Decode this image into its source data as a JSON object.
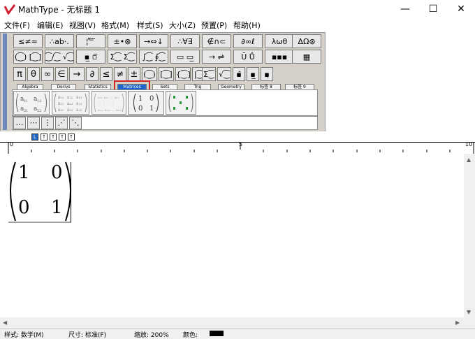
{
  "window": {
    "title": "MathType - 无标题 1",
    "controls": {
      "minimize": "—",
      "maximize": "☐",
      "close": "✕"
    }
  },
  "menu": [
    "文件(F)",
    "编辑(E)",
    "视图(V)",
    "格式(M)",
    "样式(S)",
    "大小(Z)",
    "预置(P)",
    "帮助(H)"
  ],
  "palette": {
    "row1": [
      "≤≠≈",
      "∴ab·.",
      "¦ ̊ ̿ ̈",
      "±•⊗",
      "→⇔↓",
      "∴∀∃",
      "∉∩⊂",
      "∂∞ℓ",
      "λωθ",
      "ΔΩ⊛"
    ],
    "row2": [
      "(⁐) [⁐]",
      "⁐/⁐ √⁐",
      "▪̲ ▫̅",
      "Σ⁐ Σ⁐",
      "∫⁐ ∮⁐",
      "▭ ▭̲",
      "→ ⇌",
      "Ū Ů",
      "▪▪▪",
      "▦"
    ],
    "row3": [
      "π",
      "θ",
      "∞",
      "∈",
      "→",
      "∂",
      "≤",
      "≠",
      "±",
      "(⁐)",
      "[⁐]",
      "{⁐}",
      "|⁐|",
      "Σ⁐",
      "√⁐",
      "▪̂",
      "▪̲",
      "▪̣"
    ],
    "tabs": [
      "Algebra",
      "Derivs",
      "Statistics",
      "Matrices",
      "Sets",
      "Trig",
      "Geometry",
      "标签 8",
      "标签 9"
    ],
    "selected_tab": "Matrices",
    "templates": [
      "a11 a12 / a21 a22",
      "3×3 matrix",
      "m×n matrix",
      "1 0 / 0 1",
      "diagonal matrix"
    ],
    "dots_row": [
      "…",
      "⋯",
      "⋮",
      "⋰",
      "⋱"
    ]
  },
  "ruler_buttons": [
    "L",
    "↑",
    "↑",
    "↑",
    "↑"
  ],
  "ruler_labels": [
    "0",
    "5",
    "10"
  ],
  "equation": {
    "matrix": [
      [
        "1",
        "0"
      ],
      [
        "0",
        "1"
      ]
    ]
  },
  "status": {
    "style": "样式: 数学(M)",
    "size": "尺寸: 标准(F)",
    "zoom": "缩放: 200%",
    "color": "颜色:",
    "color_swatch": "#000000"
  },
  "colors": {
    "accent": "#1e66c8",
    "highlight": "#d12424"
  }
}
